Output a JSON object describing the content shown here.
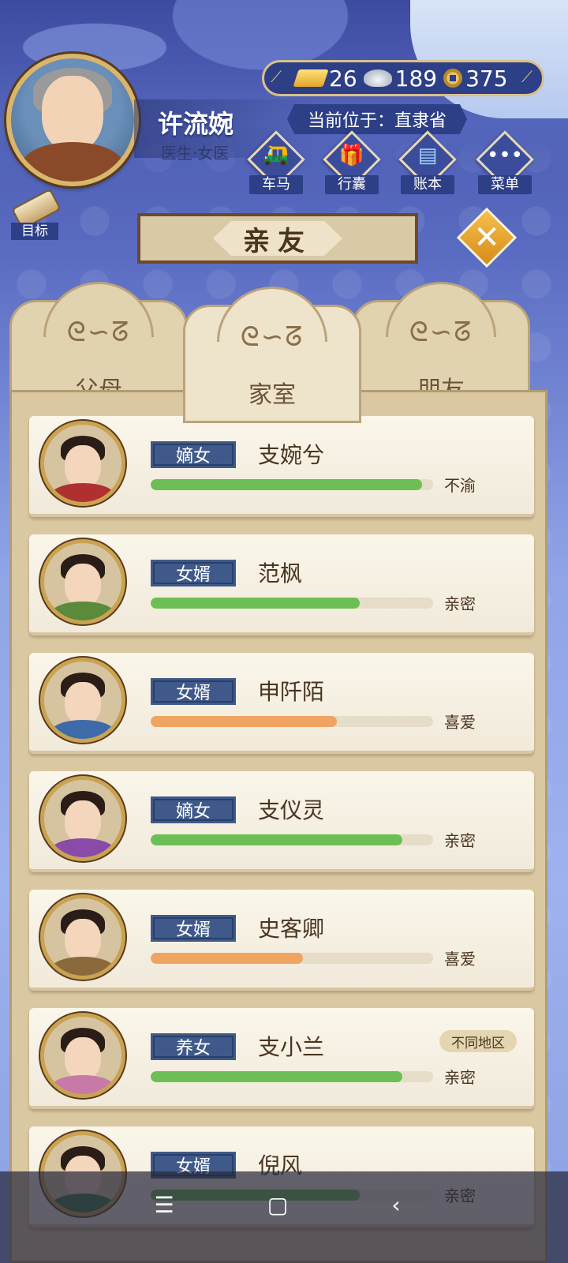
{
  "header": {
    "player_name": "许流婉",
    "player_title": "医生·女医",
    "location": "当前位于：直隶省",
    "currency": {
      "gold": "26",
      "silver": "189",
      "coins": "375"
    },
    "menu": [
      {
        "label": "车马",
        "glyph": "🛺"
      },
      {
        "label": "行囊",
        "glyph": "🎁"
      },
      {
        "label": "账本",
        "glyph": "▤"
      },
      {
        "label": "菜单",
        "glyph": "•••"
      }
    ],
    "goal_label": "目标"
  },
  "title": "亲友",
  "tabs": [
    {
      "label": "父母",
      "active": false
    },
    {
      "label": "家室",
      "active": true
    },
    {
      "label": "朋友",
      "active": false
    }
  ],
  "relations": [
    {
      "relation": "嫡女",
      "name": "支婉兮",
      "status": "不渝",
      "affinity": 0.96,
      "bar_color": "#6cbf55",
      "garment": "#b03030",
      "region": ""
    },
    {
      "relation": "女婿",
      "name": "范枫",
      "status": "亲密",
      "affinity": 0.74,
      "bar_color": "#6cbf55",
      "garment": "#5a8a3a",
      "region": ""
    },
    {
      "relation": "女婿",
      "name": "申阡陌",
      "status": "喜爱",
      "affinity": 0.66,
      "bar_color": "#f0a462",
      "garment": "#3d6aa8",
      "region": ""
    },
    {
      "relation": "嫡女",
      "name": "支仪灵",
      "status": "亲密",
      "affinity": 0.89,
      "bar_color": "#6cbf55",
      "garment": "#8a4aa8",
      "region": ""
    },
    {
      "relation": "女婿",
      "name": "史客卿",
      "status": "喜爱",
      "affinity": 0.54,
      "bar_color": "#f0a462",
      "garment": "#8a6a3a",
      "region": ""
    },
    {
      "relation": "养女",
      "name": "支小兰",
      "status": "亲密",
      "affinity": 0.89,
      "bar_color": "#6cbf55",
      "garment": "#c77aa8",
      "region": "不同地区"
    },
    {
      "relation": "女婿",
      "name": "倪风",
      "status": "亲密",
      "affinity": 0.74,
      "bar_color": "#6cbf55",
      "garment": "#3a7a4a",
      "region": ""
    }
  ],
  "navbar": {
    "menu_icon": "☰",
    "home_icon": "▢",
    "back_icon": "‹"
  }
}
